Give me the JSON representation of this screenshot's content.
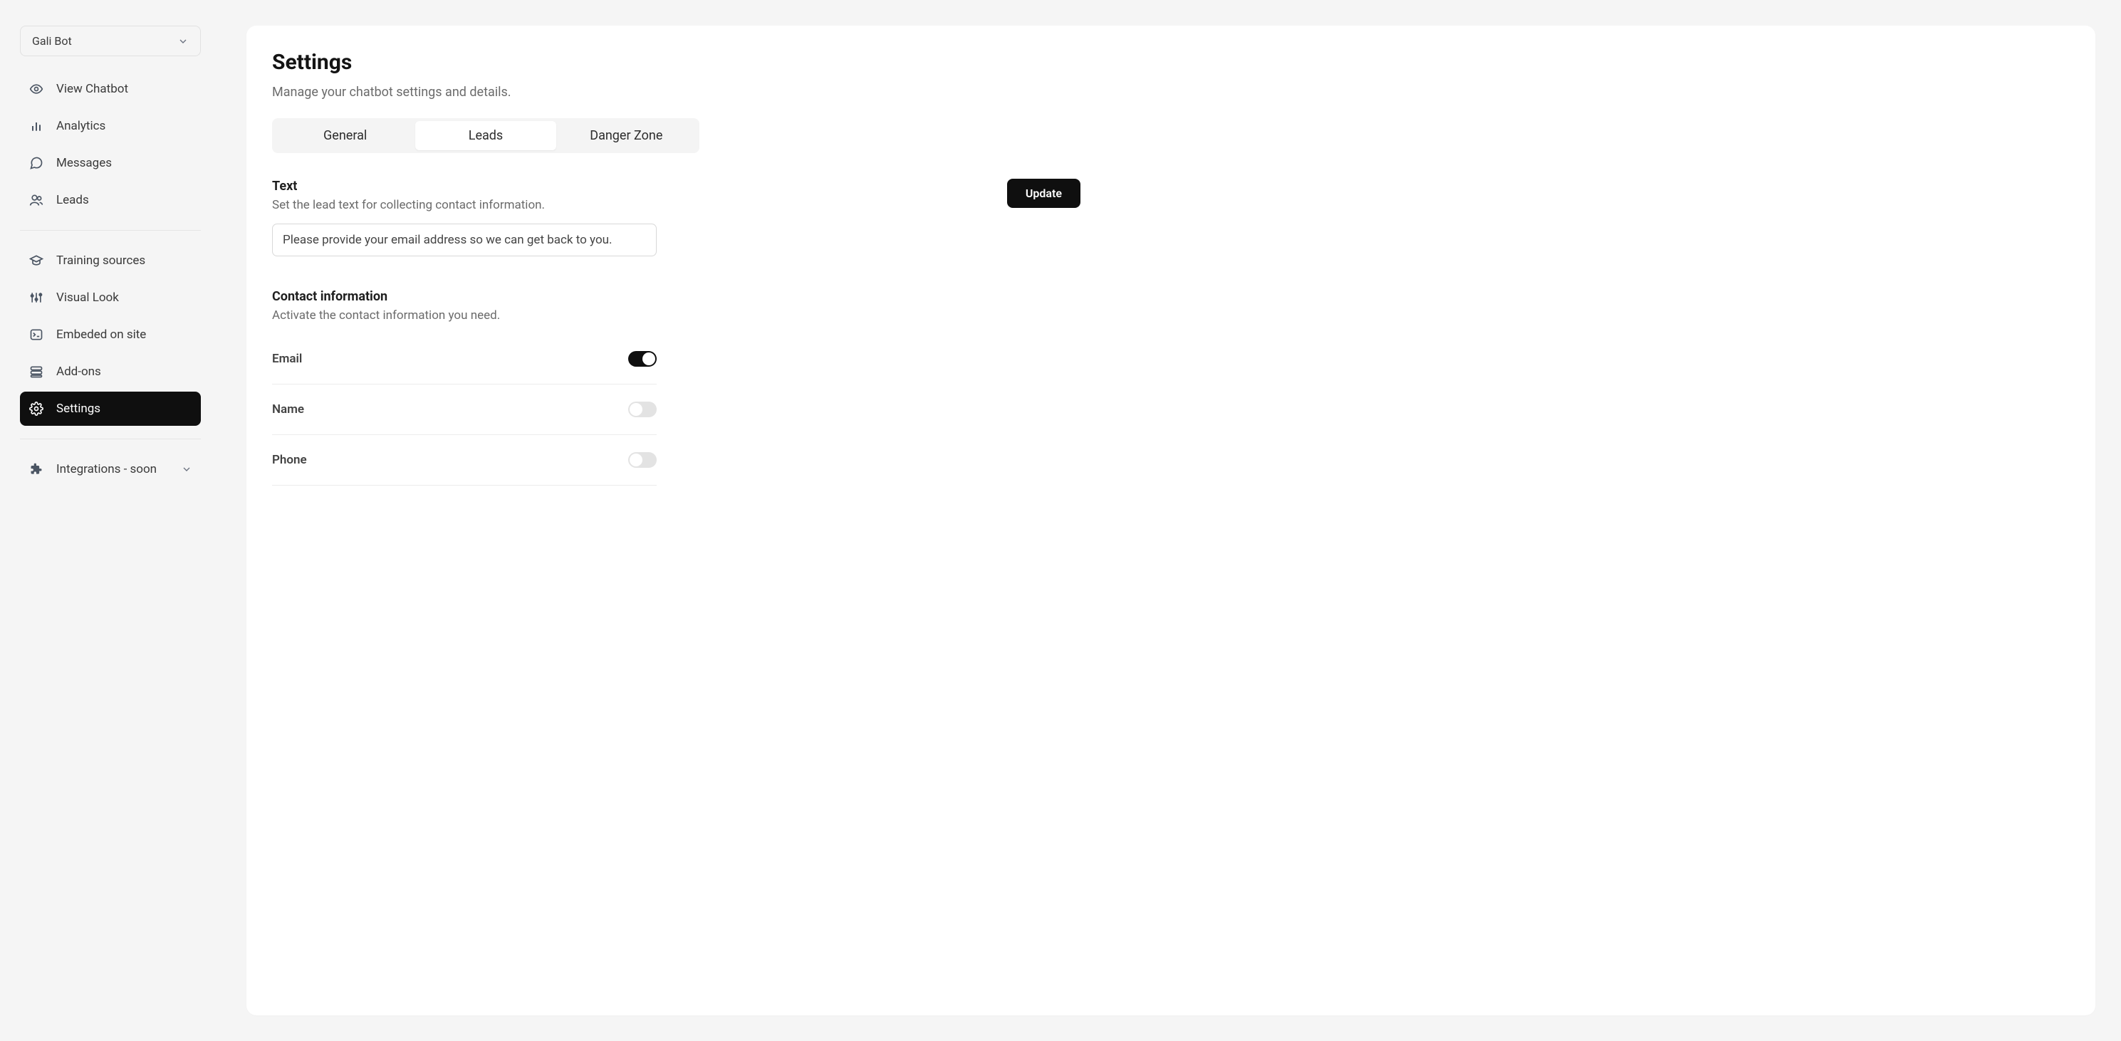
{
  "selector": {
    "label": "Gali Bot"
  },
  "sidebar": {
    "group1": [
      {
        "label": "View Chatbot"
      },
      {
        "label": "Analytics"
      },
      {
        "label": "Messages"
      },
      {
        "label": "Leads"
      }
    ],
    "group2": [
      {
        "label": "Training sources"
      },
      {
        "label": "Visual Look"
      },
      {
        "label": "Embeded on site"
      },
      {
        "label": "Add-ons"
      },
      {
        "label": "Settings"
      }
    ],
    "integrations_label": "Integrations - soon"
  },
  "page": {
    "title": "Settings",
    "subtitle": "Manage your chatbot settings and details."
  },
  "tabs": [
    {
      "label": "General"
    },
    {
      "label": "Leads"
    },
    {
      "label": "Danger Zone"
    }
  ],
  "lead_text": {
    "title": "Text",
    "subtitle": "Set the lead text for collecting contact information.",
    "value": "Please provide your email address so we can get back to you."
  },
  "contact": {
    "title": "Contact information",
    "subtitle": "Activate the contact information you need.",
    "rows": [
      {
        "label": "Email",
        "on": true
      },
      {
        "label": "Name",
        "on": false
      },
      {
        "label": "Phone",
        "on": false
      }
    ]
  },
  "buttons": {
    "update": "Update"
  }
}
